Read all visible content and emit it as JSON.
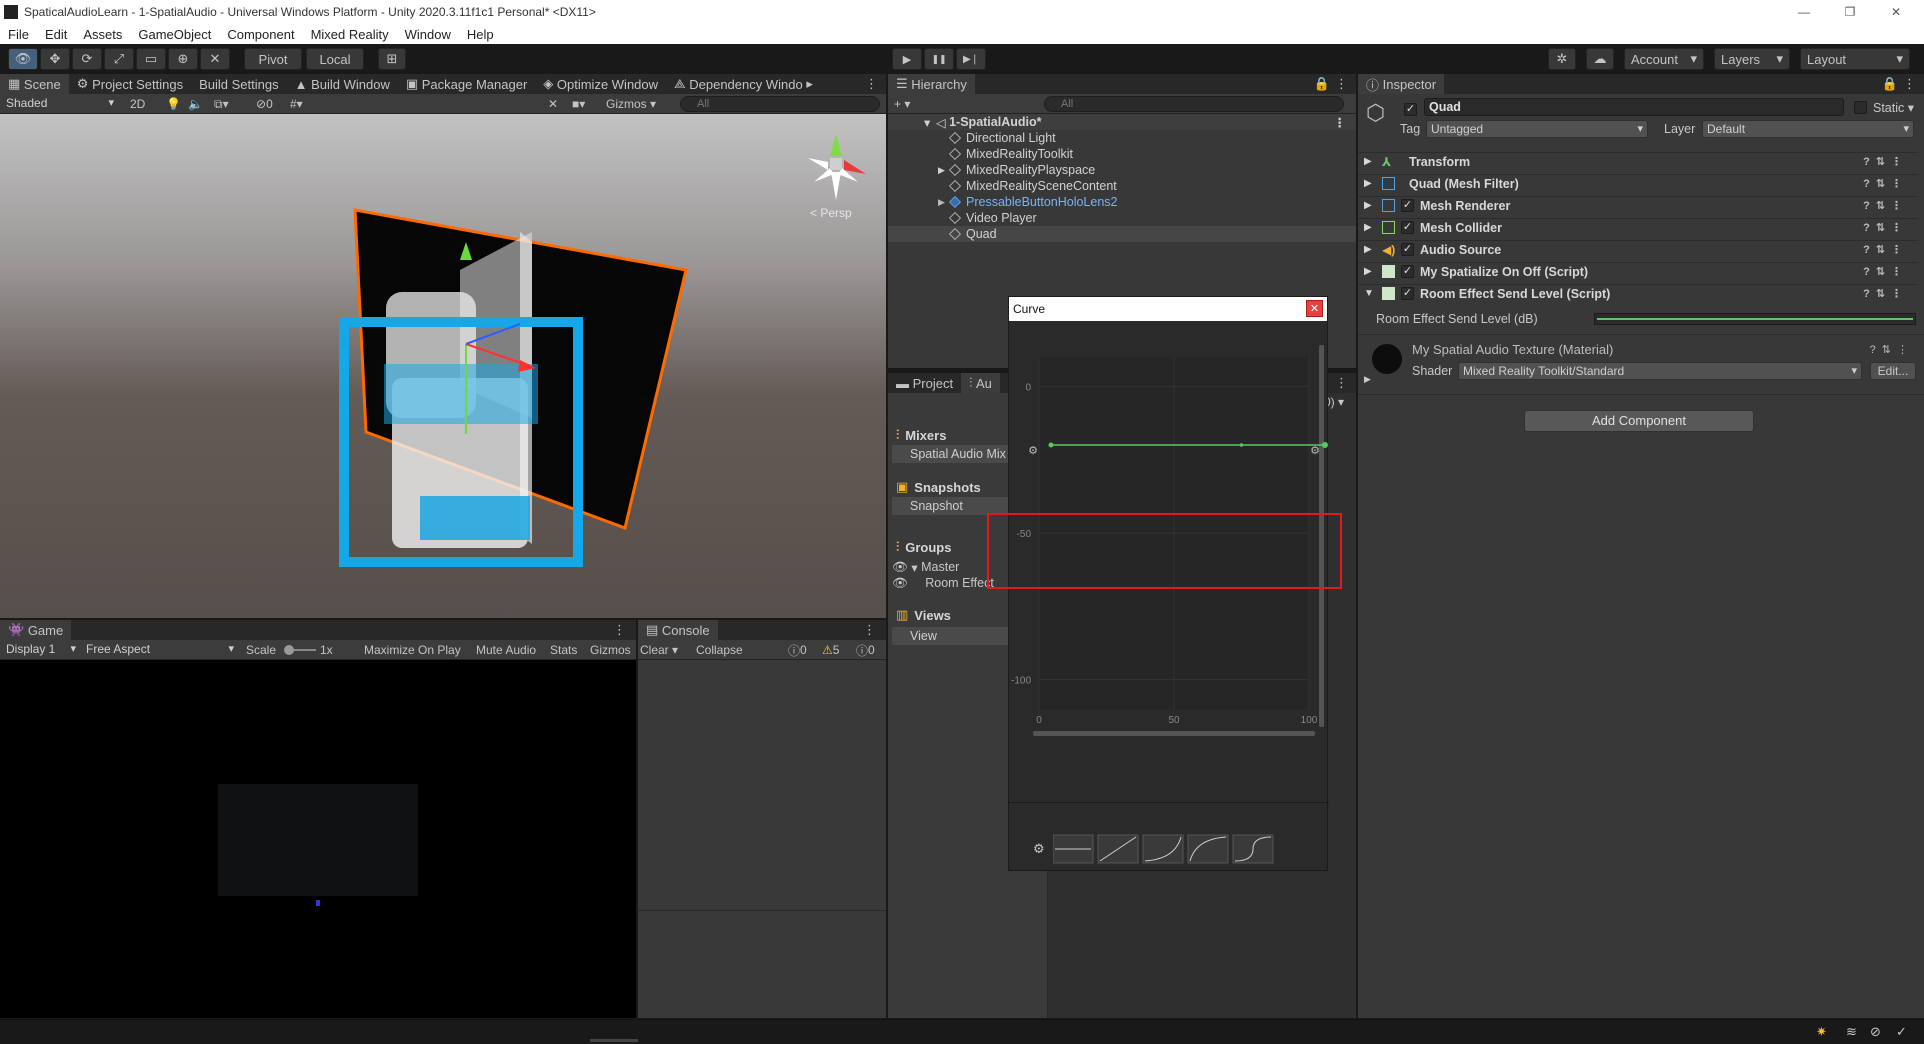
{
  "window": {
    "title": "SpaticalAudioLearn - 1-SpatialAudio - Universal Windows Platform - Unity 2020.3.11f1c1 Personal* <DX11>",
    "minimize": "—",
    "restore": "❐",
    "close": "✕"
  },
  "menu": [
    "File",
    "Edit",
    "Assets",
    "GameObject",
    "Component",
    "Mixed Reality",
    "Window",
    "Help"
  ],
  "toolbar": {
    "pivot": "Pivot",
    "local": "Local",
    "play": "▶",
    "pause": "❚❚",
    "step": "▶❘",
    "account": "Account",
    "layers": "Layers",
    "layout": "Layout"
  },
  "scene_tabs": [
    "Scene",
    "Project Settings",
    "Build Settings",
    "Build Window",
    "Package Manager",
    "Optimize Window",
    "Dependency Windo"
  ],
  "scene_bar": {
    "shading": "Shaded",
    "mode2d": "2D",
    "hidden_count": "0",
    "gizmos": "Gizmos",
    "search_placeholder": "All",
    "persp": "< Persp"
  },
  "game": {
    "tab": "Game",
    "display": "Display 1",
    "aspect": "Free Aspect",
    "scale_label": "Scale",
    "scale_value": "1x",
    "maximize": "Maximize On Play",
    "mute": "Mute Audio",
    "stats": "Stats",
    "gizmos": "Gizmos"
  },
  "console": {
    "tab": "Console",
    "clear": "Clear",
    "collapse": "Collapse",
    "info_count": "0",
    "warn_count": "5",
    "error_count": "0"
  },
  "hierarchy": {
    "tab": "Hierarchy",
    "search_placeholder": "All",
    "root": "1-SpatialAudio*",
    "items": [
      {
        "label": "Directional Light",
        "expandable": false,
        "prefab": false
      },
      {
        "label": "MixedRealityToolkit",
        "expandable": false,
        "prefab": false
      },
      {
        "label": "MixedRealityPlayspace",
        "expandable": true,
        "prefab": false
      },
      {
        "label": "MixedRealitySceneContent",
        "expandable": false,
        "prefab": false
      },
      {
        "label": "PressableButtonHoloLens2",
        "expandable": true,
        "prefab": true
      },
      {
        "label": "Video Player",
        "expandable": false,
        "prefab": false
      },
      {
        "label": "Quad",
        "expandable": false,
        "prefab": false,
        "selected": true
      }
    ]
  },
  "project_tabs": [
    "Project",
    "Au"
  ],
  "mixer": {
    "dropdown_fragment": "0)",
    "mixers_title": "Mixers",
    "mixer_item": "Spatial Audio Mix",
    "snapshots_title": "Snapshots",
    "snapshot_item": "Snapshot",
    "groups_title": "Groups",
    "group_master": "Master",
    "group_child": "Room Effect",
    "views_title": "Views",
    "view_item": "View"
  },
  "curve": {
    "title": "Curve",
    "y_ticks": [
      "0",
      "-50",
      "-100"
    ],
    "x_ticks": [
      "0",
      "50",
      "100"
    ],
    "line_value_db": -20,
    "x_range": [
      0,
      100
    ],
    "y_range": [
      -110,
      10
    ],
    "line_color": "#5fc65f",
    "highlight_color": "#e01b1b"
  },
  "inspector": {
    "tab": "Inspector",
    "object_name": "Quad",
    "static": "Static",
    "tag_label": "Tag",
    "tag_value": "Untagged",
    "layer_label": "Layer",
    "layer_value": "Default",
    "components": [
      {
        "name": "Transform",
        "check": false,
        "icon": "transform-icon"
      },
      {
        "name": "Quad (Mesh Filter)",
        "check": false,
        "icon": "mesh-filter-icon"
      },
      {
        "name": "Mesh Renderer",
        "check": true,
        "icon": "mesh-renderer-icon"
      },
      {
        "name": "Mesh Collider",
        "check": true,
        "icon": "mesh-collider-icon"
      },
      {
        "name": "Audio Source",
        "check": true,
        "icon": "audio-source-icon"
      },
      {
        "name": "My Spatialize On Off (Script)",
        "check": true,
        "icon": "script-icon"
      },
      {
        "name": "Room Effect Send Level (Script)",
        "check": true,
        "icon": "script-icon"
      }
    ],
    "send_level_label": "Room Effect Send Level (dB)",
    "material_name": "My Spatial Audio Texture (Material)",
    "shader_label": "Shader",
    "shader_value": "Mixed Reality Toolkit/Standard",
    "edit": "Edit...",
    "add_component": "Add Component"
  }
}
